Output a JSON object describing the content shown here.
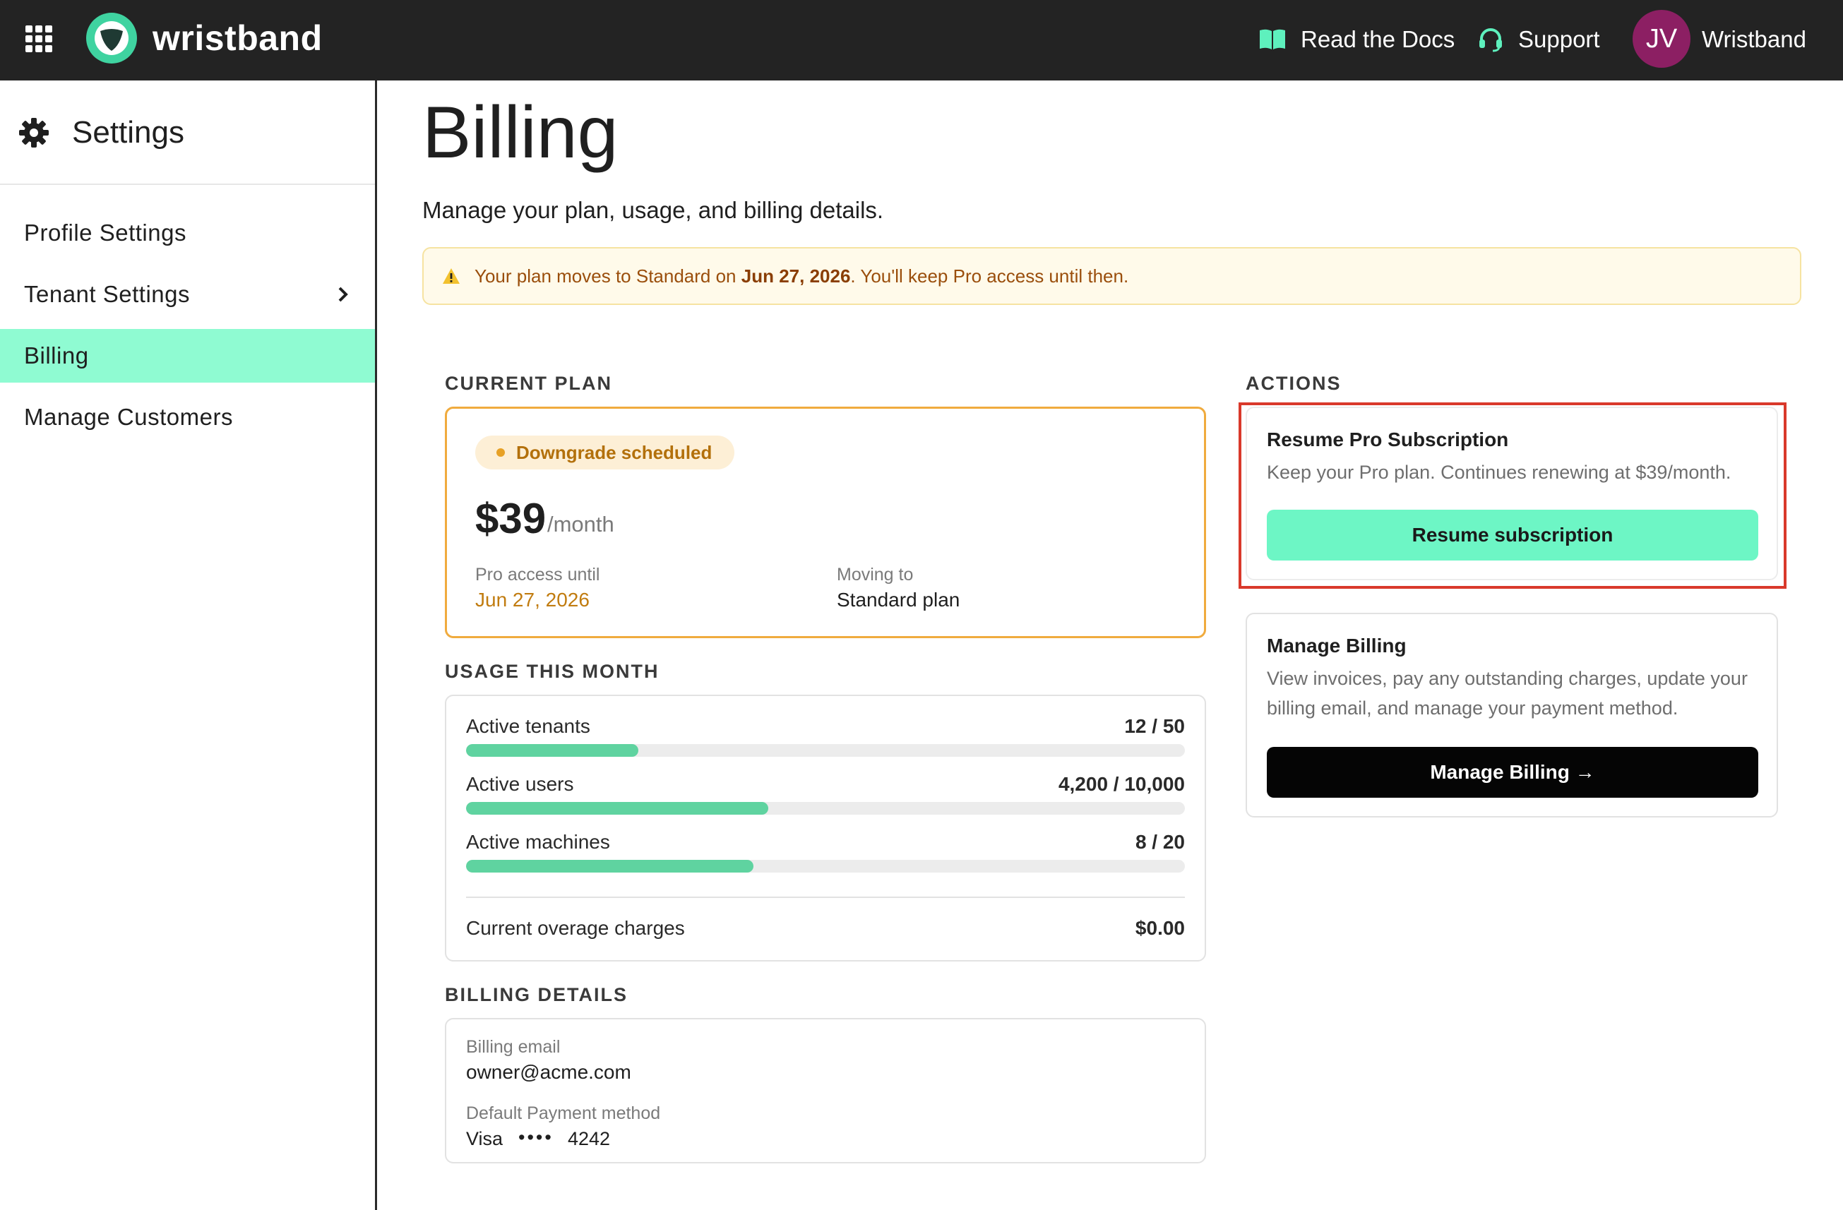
{
  "topbar": {
    "brand": "wristband",
    "docs_label": "Read the Docs",
    "support_label": "Support",
    "avatar_initials": "JV",
    "account_name": "Wristband",
    "icons": [
      "apps-grid-icon",
      "wristband-logo",
      "book-icon",
      "headset-icon"
    ]
  },
  "sidebar": {
    "title": "Settings",
    "items": [
      {
        "label": "Profile Settings"
      },
      {
        "label": "Tenant Settings"
      },
      {
        "label": "Billing",
        "active": true
      },
      {
        "label": "Manage Customers"
      }
    ]
  },
  "page": {
    "title": "Billing",
    "subtitle": "Manage your plan, usage, and billing details."
  },
  "alert": {
    "prefix": "Your plan moves to Standard on ",
    "date": "Jun 27, 2026",
    "suffix": ". You'll keep Pro access until then."
  },
  "current_plan": {
    "section_label": "CURRENT PLAN",
    "badge": "Downgrade scheduled",
    "price": "$39",
    "price_unit": "/month",
    "access_label": "Pro access until",
    "access_value": "Jun 27, 2026",
    "moving_label": "Moving to",
    "moving_value": "Standard plan"
  },
  "usage": {
    "section_label": "USAGE THIS MONTH",
    "rows": [
      {
        "label": "Active tenants",
        "value": "12 / 50",
        "fraction": 0.24
      },
      {
        "label": "Active users",
        "value": "4,200 / 10,000",
        "fraction": 0.42
      },
      {
        "label": "Active machines",
        "value": "8 / 20",
        "fraction": 0.4
      }
    ],
    "overage_label": "Current overage charges",
    "overage_value": "$0.00"
  },
  "billing_details": {
    "section_label": "BILLING DETAILS",
    "email_label": "Billing email",
    "email_value": "owner@acme.com",
    "payment_label": "Default Payment method",
    "card_brand": "Visa",
    "card_mask": "••••",
    "card_last4": "4242"
  },
  "actions": {
    "section_label": "ACTIONS",
    "resume": {
      "title": "Resume Pro Subscription",
      "description": "Keep your Pro plan. Continues renewing at $39/month.",
      "button": "Resume subscription"
    },
    "manage": {
      "title": "Manage Billing",
      "description": "View invoices, pay any outstanding charges, update your billing email, and manage your payment method.",
      "button": "Manage Billing →"
    }
  },
  "colors": {
    "topbar_bg": "#232323",
    "accent_mint": "#6df6c5",
    "active_nav": "#8ffbd2",
    "warning_border": "#f0ab3e",
    "warning_text": "#b3700b",
    "avatar_bg": "#8c1f63",
    "highlight": "#d9392b"
  }
}
